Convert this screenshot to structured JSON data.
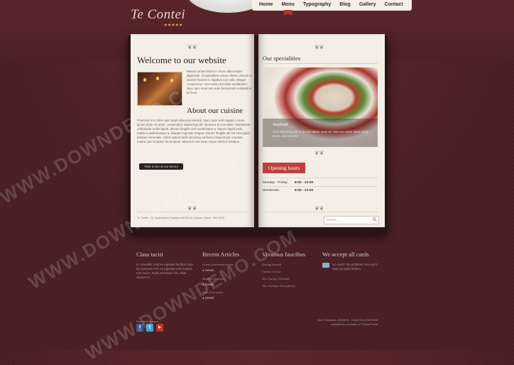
{
  "brand": {
    "logo_text": "Te Contei",
    "stars": "★★★★★"
  },
  "nav": {
    "items": [
      "Home",
      "Menu",
      "Typography",
      "Blog",
      "Gallery",
      "Contact"
    ]
  },
  "left_page": {
    "welcome_title": "Welcome to our website",
    "welcome_text": "Mauris ornare libero in risus ullamcorper dignissim. Suspendisse ornare libero, dictum et laoreet hendrerit, dapibus non velit. Integer consectetur commodo erat vitae vestibulum. Nam quis enim non ante fermentum volutpat et at risus.",
    "cuisine_title": "About our cuisine",
    "cuisine_text": "Praesent non dolor quis turpis placerat suscipit. Nunc quis velit magna. Lorem ipsum dolor sit amet, consectetur adipiscing elit. Vivamus at erat dolor. Vestibulum sollicitudin mollis ligula, dictum fringilla velit scelerisque a. Mauris ligula justo, mattis a pellentesque a, aliquam egestas magna. Donec fringilla elit vel erat quam tempus venenatis. Class aptent taciti sociosqu ad litora torquent per conubia nostra, per inceptos himenaeos. Mauris in est risus neque ultrices tristique.",
    "tour_button": "Take a tour at our menu!",
    "address": "Te Contei - Av. Barbalianes Oquiano 46 Rio De Janeiro, Brazil - 893 4475"
  },
  "right_page": {
    "specialities_title": "Our specialities",
    "food_title": "Seafood",
    "food_text": "Ut id adipiscing elit. In at erat vulum. Duis vel amet nec tortor lacus porta lectus. Sed lobortis.",
    "hours_button": "Opening hours",
    "hours": [
      {
        "day": "Monday - Friday:",
        "time": "8:00 - 22:00"
      },
      {
        "day": "Weekends:",
        "time": "9:00 - 23:00"
      }
    ],
    "search_placeholder": "Search..."
  },
  "footer": {
    "col1": {
      "title": "Class taciti",
      "text": "In convallis, velit eu egestas facilisis ante leo posuere nisl, eu egestas velit mauris, non lorem. Nulla at tempor est, vitae aliquet mi."
    },
    "col2": {
      "title": "Recent Articles",
      "items": [
        {
          "title": "Lorem fermentum auctor",
          "detail": "Details"
        },
        {
          "title": "Mauris vel ornare",
          "detail": "Details"
        },
        {
          "title": "Nam in eu turpis",
          "detail": "Details"
        }
      ]
    },
    "col3": {
      "title": "Vivamus faucibus",
      "links": [
        "Getting Started",
        "Cursus eros tur",
        "The Journey Onwards",
        "The Journey's Scrumptuity"
      ]
    },
    "col4": {
      "title": "We accept all cards",
      "text": "No cash? No problem! You won't have to wash dishes."
    },
    "social_label": "Our social network",
    "credits": "More Templates 365/WEB - Collect from 365/WEB available for purchase on ThemeForest"
  },
  "watermarks": [
    "WWW.DOWNDEMO.COM",
    "WWW.DOWNDEMO.COM",
    "WWW.DOWNDEMO.COM"
  ],
  "colors": {
    "background": "#4a1f23",
    "accent_red": "#c0403d",
    "paper": "#f3efe6"
  }
}
